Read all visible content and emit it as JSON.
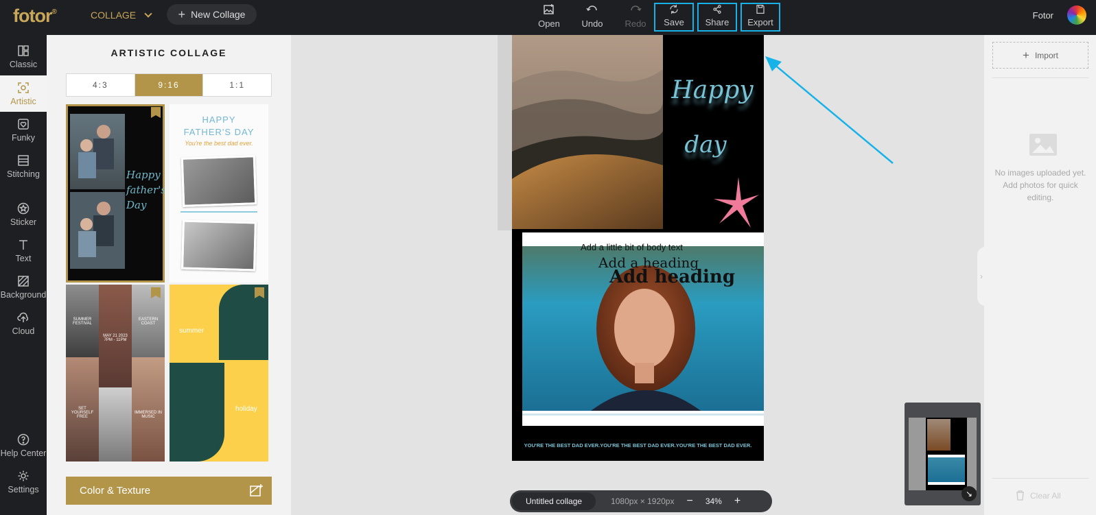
{
  "app": {
    "logo": "fotor",
    "trademark": "®"
  },
  "header": {
    "collage_menu": "COLLAGE",
    "new_collage": "New Collage",
    "tools": [
      {
        "label": "Open",
        "icon": "image-open-icon"
      },
      {
        "label": "Undo",
        "icon": "undo-icon"
      },
      {
        "label": "Redo",
        "icon": "redo-icon",
        "disabled": true
      },
      {
        "label": "Save",
        "icon": "save-sync-icon",
        "highlighted": true
      },
      {
        "label": "Share",
        "icon": "share-icon",
        "highlighted": true
      },
      {
        "label": "Export",
        "icon": "export-icon",
        "highlighted": true
      }
    ],
    "user": "Fotor"
  },
  "nav": {
    "items": [
      {
        "label": "Classic",
        "icon": "grid-icon"
      },
      {
        "label": "Artistic",
        "icon": "artistic-icon",
        "active": true
      },
      {
        "label": "Funky",
        "icon": "heart-frame-icon"
      },
      {
        "label": "Stitching",
        "icon": "stitching-icon"
      },
      {
        "label": "Sticker",
        "icon": "star-circle-icon"
      },
      {
        "label": "Text",
        "icon": "text-t-icon"
      },
      {
        "label": "Background",
        "icon": "background-hatch-icon"
      },
      {
        "label": "Cloud",
        "icon": "cloud-upload-icon"
      }
    ],
    "bottom": [
      {
        "label": "Help Center",
        "icon": "help-icon"
      },
      {
        "label": "Settings",
        "icon": "gear-icon"
      }
    ]
  },
  "panel": {
    "title": "ARTISTIC COLLAGE",
    "ratios": [
      {
        "label": "4:3"
      },
      {
        "label": "9:16",
        "active": true
      },
      {
        "label": "1:1"
      }
    ],
    "templates": {
      "t1": {
        "side_text1": "Happy",
        "side_text2": "father's",
        "side_text3": "Day"
      },
      "t2": {
        "line1": "HAPPY",
        "line2": "FATHER'S DAY",
        "line3": "You're the best dad ever."
      },
      "t3": {
        "label1": "SUMMER FESTIVAL",
        "label2": "EASTERN COAST",
        "label3": "MAY 21 2023 7PM - 11PM",
        "label4": "SET YOURSELF FREE",
        "label5": "IMMERSED IN MUSIC"
      },
      "t4": {
        "label1": "summer",
        "label2": "holiday"
      }
    },
    "color_texture": "Color & Texture"
  },
  "canvas": {
    "poster": {
      "script_line1": "Happy",
      "script_line2": "day",
      "body_text": "Add a little bit of body text",
      "subheading": "Add a heading",
      "heading": "Add heading",
      "footer": "YOU'RE THE BEST DAD EVER.YOU'RE THE BEST DAD EVER.YOU'RE THE BEST DAD EVER."
    },
    "bottombar": {
      "title": "Untitled collage",
      "dims": "1080px × 1920px",
      "minus": "−",
      "zoom": "34%",
      "plus": "+"
    },
    "minimap_expand": "↘"
  },
  "right": {
    "import": "Import",
    "empty": "No images uploaded yet. Add photos for quick editing.",
    "clear_all": "Clear All",
    "handle": "›"
  },
  "colors": {
    "accent": "#b39549",
    "highlight": "#17b3e8",
    "dark": "#1e1f22"
  }
}
